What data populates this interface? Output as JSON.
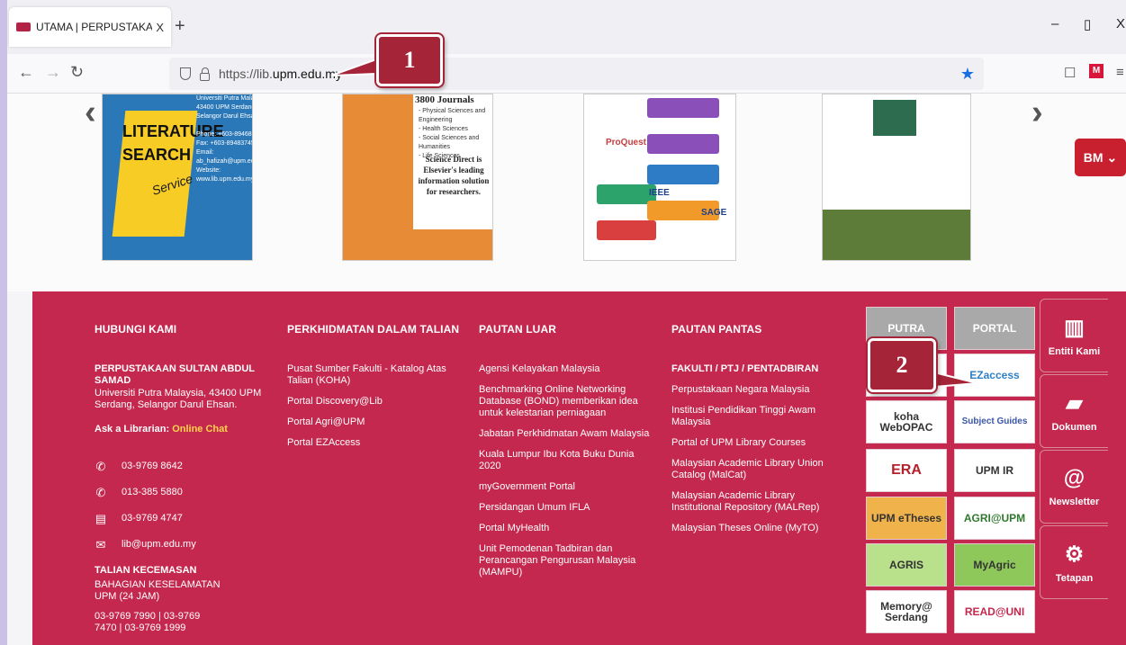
{
  "browser": {
    "tab_title": "UTAMA | PERPUSTAKAAN SULTA",
    "tab_close": "X",
    "new_tab": "+",
    "url_prefix": "https://lib.",
    "url_host": "upm.edu.my",
    "window_controls": [
      "–",
      "▯",
      "X"
    ],
    "ext_label": "M"
  },
  "carousel": {
    "card1": {
      "title_line1": "LITERATURE",
      "title_line2": "SEARCH",
      "script": "Service",
      "address": [
        "Universiti Putra Malaysia",
        "43400 UPM Serdang",
        "Selangor Darul Ehsan.",
        "",
        "Phone: +603-89468642",
        "Fax: +603-89483745",
        "Email: ab_hafizah@upm.edu.my",
        "Website: www.lib.upm.edu.my"
      ]
    },
    "card2": {
      "headline": "3800 Journals",
      "bullets": [
        "- Physical Sciences and Engineering",
        "- Health Sciences",
        "- Social Sciences and Humanities",
        "- Life Sciences"
      ],
      "tagline": "Science Direct is Elsevier's leading information solution for researchers."
    },
    "card3": {
      "brands": [
        "ProQuest",
        "IEEE",
        "SAGE"
      ]
    }
  },
  "language_button": "BM ⌄",
  "footer": {
    "headers": {
      "contact": "HUBUNGI KAMI",
      "online": "PERKHIDMATAN DALAM TALIAN",
      "external": "PAUTAN LUAR",
      "quick": "PAUTAN PANTAS"
    },
    "contact": {
      "library_name": "PERPUSTAKAAN SULTAN ABDUL SAMAD",
      "address": "Universiti Putra Malaysia, 43400 UPM Serdang, Selangor Darul Ehsan.",
      "ask_label": "Ask a Librarian:",
      "ask_link": "Online Chat",
      "phone1": "03-9769 8642",
      "phone2": "013-385 5880",
      "fax": "03-9769 4747",
      "email": "lib@upm.edu.my",
      "emergency_title": "TALIAN KECEMASAN",
      "emergency_unit": "BAHAGIAN KESELAMATAN UPM (24 JAM)",
      "emergency_phones": "03-9769 7990 | 03-9769 7470 | 03-9769 1999"
    },
    "online_services": [
      "Pusat Sumber Fakulti - Katalog Atas Talian (KOHA)",
      "Portal Discovery@Lib",
      "Portal Agri@UPM",
      "Portal EZAccess"
    ],
    "external_links": [
      "Agensi Kelayakan Malaysia",
      "Benchmarking Online Networking Database (BOND) memberikan idea untuk kelestarian perniagaan",
      "Jabatan Perkhidmatan Awam Malaysia",
      "Kuala Lumpur Ibu Kota Buku Dunia 2020",
      "myGovernment Portal",
      "Persidangan Umum IFLA",
      "Portal MyHealth",
      "Unit Pemodenan Tadbiran dan Perancangan Pengurusan Malaysia (MAMPU)"
    ],
    "quick_subtitle": "FAKULTI / PTJ / PENTADBIRAN",
    "quick_links": [
      "Perpustakaan Negara Malaysia",
      "Institusi Pendidikan Tinggi Awam Malaysia",
      "Portal of UPM Library Courses",
      "Malaysian Academic Library Union Catalog (MalCat)",
      "Malaysian Academic Library Institutional Repository (MALRep)",
      "Malaysian Theses Online (MyTO)"
    ],
    "tiles": [
      "PUTRA",
      "PORTAL",
      "",
      "EZaccess",
      "koha WebOPAC",
      "Subject Guides",
      "ERA",
      "UPM IR",
      "UPM eTheses",
      "AGRI@UPM",
      "AGRIS",
      "MyAgric",
      "Memory@ Serdang",
      "READ@UNI"
    ],
    "side_menu": [
      "Entiti Kami",
      "Dokumen",
      "Newsletter",
      "Tetapan"
    ]
  },
  "callouts": [
    "1",
    "2"
  ],
  "colors": {
    "footer_bg": "#c4284e",
    "callout_bg": "#a52438",
    "accent_yellow": "#ffd34d",
    "star_blue": "#1a6fe0"
  }
}
